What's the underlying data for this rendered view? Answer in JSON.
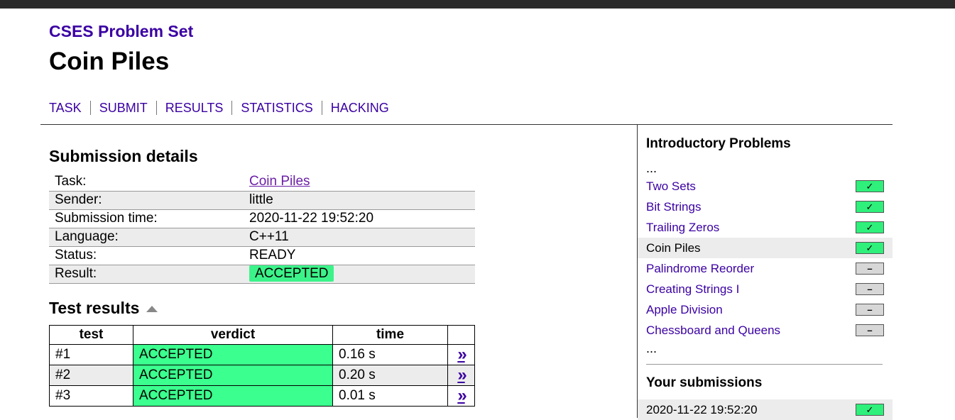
{
  "site_title": "CSES Problem Set",
  "page_title": "Coin Piles",
  "nav": [
    "TASK",
    "SUBMIT",
    "RESULTS",
    "STATISTICS",
    "HACKING"
  ],
  "submission": {
    "heading": "Submission details",
    "rows": [
      {
        "label": "Task:",
        "value": "Coin Piles"
      },
      {
        "label": "Sender:",
        "value": "little"
      },
      {
        "label": "Submission time:",
        "value": "2020-11-22 19:52:20"
      },
      {
        "label": "Language:",
        "value": "C++11"
      },
      {
        "label": "Status:",
        "value": "READY"
      },
      {
        "label": "Result:",
        "value": "ACCEPTED"
      }
    ]
  },
  "tests": {
    "heading": "Test results",
    "columns": [
      "test",
      "verdict",
      "time"
    ],
    "rows": [
      {
        "test": "#1",
        "verdict": "ACCEPTED",
        "time": "0.16 s",
        "link": "»"
      },
      {
        "test": "#2",
        "verdict": "ACCEPTED",
        "time": "0.20 s",
        "link": "»"
      },
      {
        "test": "#3",
        "verdict": "ACCEPTED",
        "time": "0.01 s",
        "link": "»"
      }
    ]
  },
  "sidebar": {
    "section_title": "Introductory Problems",
    "ellipsis": "...",
    "problems": [
      {
        "name": "Two Sets",
        "status": "solved",
        "mark": "✓"
      },
      {
        "name": "Bit Strings",
        "status": "solved",
        "mark": "✓"
      },
      {
        "name": "Trailing Zeros",
        "status": "solved",
        "mark": "✓"
      },
      {
        "name": "Coin Piles",
        "status": "solved",
        "mark": "✓",
        "current": true
      },
      {
        "name": "Palindrome Reorder",
        "status": "unsolved",
        "mark": "–"
      },
      {
        "name": "Creating Strings I",
        "status": "unsolved",
        "mark": "–"
      },
      {
        "name": "Apple Division",
        "status": "unsolved",
        "mark": "–"
      },
      {
        "name": "Chessboard and Queens",
        "status": "unsolved",
        "mark": "–"
      }
    ],
    "submissions_title": "Your submissions",
    "submissions": [
      {
        "time": "2020-11-22 19:52:20",
        "mark": "✓"
      }
    ]
  },
  "colors": {
    "link": "#3a00a3",
    "accepted": "#3bff8e",
    "row_alt": "#ececec"
  }
}
